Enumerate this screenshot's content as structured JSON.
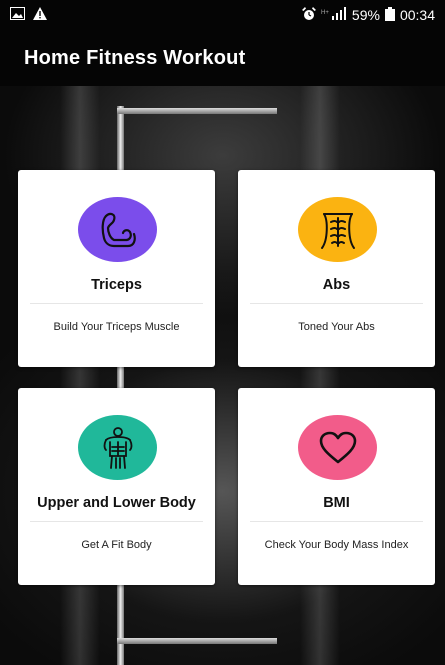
{
  "status_bar": {
    "battery": "59%",
    "time": "00:34",
    "icons": [
      "image-icon",
      "warning-icon",
      "alarm-icon",
      "signal-icon",
      "battery-icon"
    ]
  },
  "app": {
    "title": "Home Fitness Workout"
  },
  "cards": [
    {
      "title": "Triceps",
      "subtitle": "Build Your Triceps Muscle",
      "icon": "flexed-arm-icon",
      "color": "#7B4DEB"
    },
    {
      "title": "Abs",
      "subtitle": "Toned Your Abs",
      "icon": "abs-icon",
      "color": "#FBB311"
    },
    {
      "title": "Upper and Lower Body",
      "subtitle": "Get A Fit Body",
      "icon": "body-icon",
      "color": "#20B89A"
    },
    {
      "title": "BMI",
      "subtitle": "Check Your Body Mass Index",
      "icon": "heart-icon",
      "color": "#F25C8A"
    }
  ]
}
